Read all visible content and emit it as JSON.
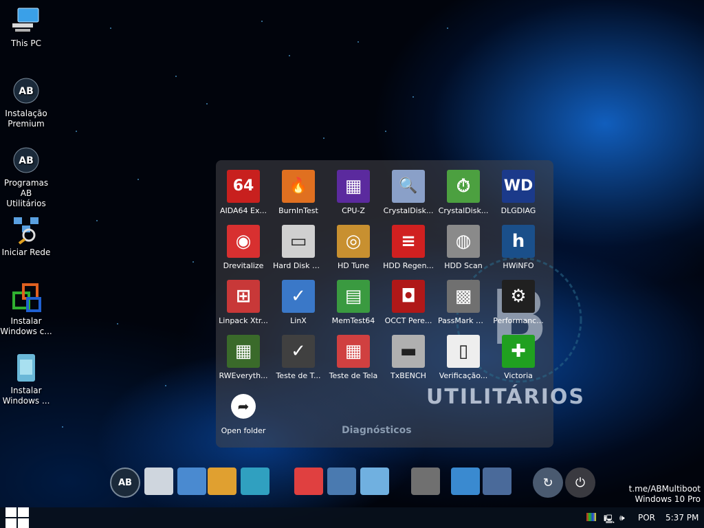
{
  "desktop": {
    "icons": [
      {
        "label": "This PC",
        "icon": "computer-icon"
      },
      {
        "label": "Instalação Premium",
        "icon": "ab-multiboot-logo"
      },
      {
        "label": "Programas AB Utilitários",
        "icon": "ab-multiboot-logo"
      },
      {
        "label": "Iniciar Rede",
        "icon": "network-icon"
      },
      {
        "label": "Instalar Windows c...",
        "icon": "windows-install-icon"
      },
      {
        "label": "Instalar Windows ...",
        "icon": "windows-install-icon"
      }
    ]
  },
  "panel": {
    "title": "Diagnósticos",
    "brand": "UTILITÁRIOS",
    "tiles": [
      {
        "label": "AIDA64 Ex...",
        "glyph": "64",
        "color": "#c8201e"
      },
      {
        "label": "BurnInTest",
        "glyph": "🔥",
        "color": "#e07020"
      },
      {
        "label": "CPU-Z",
        "glyph": "▦",
        "color": "#5b2a9e"
      },
      {
        "label": "CrystalDisk...",
        "glyph": "🔍",
        "color": "#8aa0c8"
      },
      {
        "label": "CrystalDisk...",
        "glyph": "⏱",
        "color": "#4ca040"
      },
      {
        "label": "DLGDIAG",
        "glyph": "WD",
        "color": "#1b3a8a"
      },
      {
        "label": "Drevitalize",
        "glyph": "◉",
        "color": "#d83030"
      },
      {
        "label": "Hard Disk S...",
        "glyph": "▭",
        "color": "#d0d0d0"
      },
      {
        "label": "HD Tune",
        "glyph": "◎",
        "color": "#c89030"
      },
      {
        "label": "HDD Regen...",
        "glyph": "≡",
        "color": "#d02020"
      },
      {
        "label": "HDD Scan",
        "glyph": "◍",
        "color": "#8a8a8a"
      },
      {
        "label": "HWiNFO",
        "glyph": "h",
        "color": "#1a4f8a"
      },
      {
        "label": "Linpack Xtr...",
        "glyph": "⊞",
        "color": "#c83838"
      },
      {
        "label": "LinX",
        "glyph": "✓",
        "color": "#3a78c8"
      },
      {
        "label": "MemTest64",
        "glyph": "▤",
        "color": "#3a9a40"
      },
      {
        "label": "OCCT Pere...",
        "glyph": "◘",
        "color": "#b01818"
      },
      {
        "label": "PassMark M...",
        "glyph": "▩",
        "color": "#707070"
      },
      {
        "label": "Performanc...",
        "glyph": "⚙",
        "color": "#202020"
      },
      {
        "label": "RWEveryth...",
        "glyph": "▦",
        "color": "#3a6a2a"
      },
      {
        "label": "Teste de T...",
        "glyph": "✓",
        "color": "#404040"
      },
      {
        "label": "Teste de Tela",
        "glyph": "▦",
        "color": "#d04040"
      },
      {
        "label": "TxBENCH",
        "glyph": "▬",
        "color": "#b0b0b0"
      },
      {
        "label": "Verificação...",
        "glyph": "▯",
        "color": "#eeeeee"
      },
      {
        "label": "Victoria",
        "glyph": "✚",
        "color": "#20a020"
      },
      {
        "label": "Open folder",
        "glyph": "➦",
        "color": "#ffffff"
      }
    ]
  },
  "dock": {
    "items": [
      "ab-multiboot-logo",
      "robot-icon",
      "download-drive-icon",
      "programs-collage-icon",
      "tools-collage-icon",
      "firstaid-icon",
      "pc-tools-icon",
      "charts-icon",
      "disk-icon",
      "network-tools-icon",
      "security-icon",
      "restart-icon",
      "power-icon"
    ]
  },
  "watermark": {
    "line1": "t.me/ABMultiboot",
    "line2": "Windows 10 Pro"
  },
  "taskbar": {
    "language": "POR",
    "time": "5:37 PM"
  }
}
